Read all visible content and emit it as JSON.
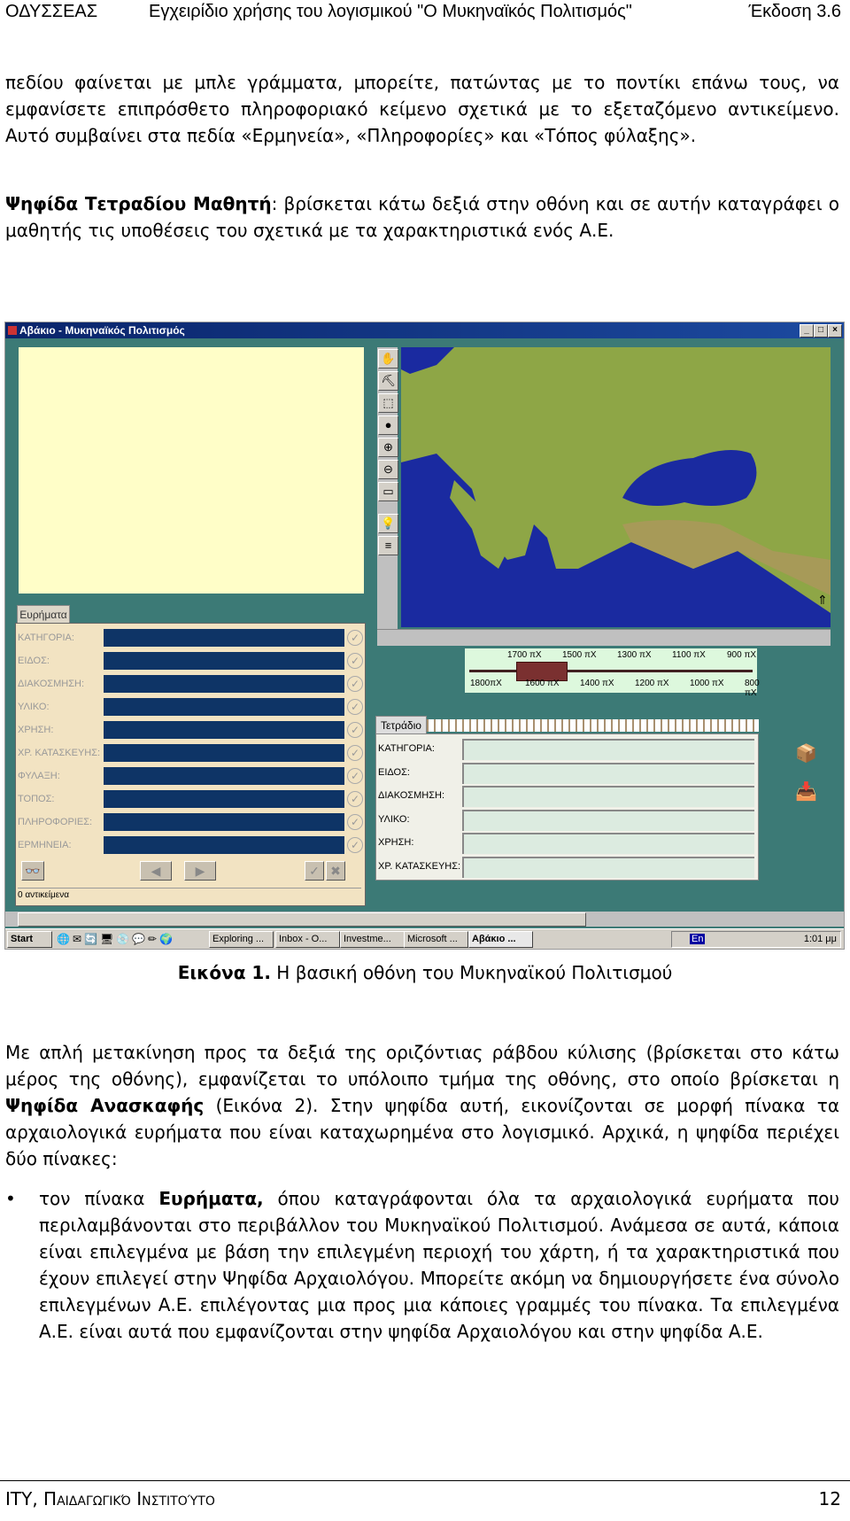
{
  "header": {
    "left": "ΟΔΥΣΣΕΑΣ",
    "center": "Εγχειρίδιο χρήσης του λογισμικού \"Ο Μυκηναϊκός Πολιτισμός\"",
    "right": "Έκδοση 3.6"
  },
  "intro": {
    "text": "πεδίου φαίνεται με μπλε γράμματα, μπορείτε, πατώντας με το ποντίκι επάνω τους, να εμφανίσετε επιπρόσθετο πληροφοριακό κείμενο σχετικά με το εξεταζόμενο αντικείμενο. Αυτό συμβαίνει στα πεδία «Ερμηνεία», «Πληροφορίες» και «Τόπος φύλαξης».",
    "bold_term": "Ψηφίδα Τετραδίου Μαθητή",
    "bold_rest": ": βρίσκεται κάτω δεξιά στην οθόνη και σε αυτήν καταγράφει ο μαθητής τις υποθέσεις του σχετικά με τα χαρακτηριστικά ενός Α.Ε."
  },
  "app": {
    "title": "Αβάκιο - Μυκηναϊκός Πολιτισμός",
    "window_buttons": [
      "_",
      "□",
      "×"
    ],
    "tools": [
      {
        "icon": "hand-icon",
        "glyph": "✋"
      },
      {
        "icon": "pickaxe-icon",
        "glyph": "⛏"
      },
      {
        "icon": "select-rect-icon",
        "glyph": "⬚"
      },
      {
        "icon": "point-icon",
        "glyph": "●"
      },
      {
        "icon": "zoom-in-icon",
        "glyph": "⊕"
      },
      {
        "icon": "zoom-out-icon",
        "glyph": "⊖"
      },
      {
        "icon": "ruler-icon",
        "glyph": "▭"
      },
      {
        "icon": "lightbulb-icon",
        "glyph": "💡"
      },
      {
        "icon": "legend-icon",
        "glyph": "≡"
      }
    ],
    "timeline": {
      "top_labels": [
        "1700 πΧ",
        "1500 πΧ",
        "1300 πΧ",
        "1100 πΧ",
        "900 πΧ"
      ],
      "bottom_labels": [
        "1800πΧ",
        "1600 πΧ",
        "1400 πΧ",
        "1200 πΧ",
        "1000 πΧ",
        "800 πΧ"
      ]
    },
    "findings": {
      "tab": "Ευρήματα",
      "fields": [
        "ΚΑΤΗΓΟΡΙΑ:",
        "ΕΙΔΟΣ:",
        "ΔΙΑΚΟΣΜΗΣΗ:",
        "ΥΛΙΚΟ:",
        "ΧΡΗΣΗ:",
        "ΧΡ. ΚΑΤΑΣΚΕΥΗΣ:",
        "ΦΥΛΑΞΗ:",
        "ΤΟΠΟΣ:",
        "ΠΛΗΡΟΦΟΡΙΕΣ:",
        "ΕΡΜΗΝΕΙΑ:"
      ],
      "status": "0 αντικείμενα",
      "bar_color": "#0e3466"
    },
    "notebook": {
      "tab": "Τετράδιο",
      "fields": [
        "ΚΑΤΗΓΟΡΙΑ:",
        "ΕΙΔΟΣ:",
        "ΔΙΑΚΟΣΜΗΣΗ:",
        "ΥΛΙΚΟ:",
        "ΧΡΗΣΗ:",
        "ΧΡ. ΚΑΤΑΣΚΕΥΗΣ:"
      ]
    },
    "taskbar": {
      "start": "Start",
      "tasks": [
        "Exploring ...",
        "Inbox - O...",
        "Investme...",
        "Microsoft ...",
        "Αβάκιο ..."
      ],
      "tray_lang": "En",
      "clock": "1:01 μμ"
    }
  },
  "caption": {
    "label": "Εικόνα 1.",
    "text": " Η βασική οθόνη του Μυκηναϊκού Πολιτισμού"
  },
  "body": {
    "p1_a": "Με απλή μετακίνηση προς τα δεξιά της οριζόντιας ράβδου κύλισης (βρίσκεται στο κάτω μέρος της οθόνης), εμφανίζεται το υπόλοιπο τμήμα της οθόνης, στο οποίο βρίσκεται η ",
    "p1_bold": "Ψηφίδα Ανασκαφής",
    "p1_b": " (Εικόνα 2). Στην ψηφίδα αυτή, εικονίζονται σε μορφή πίνακα τα αρχαιολογικά ευρήματα που είναι καταχωρημένα στο λογισμικό. Αρχικά, η ψηφίδα περιέχει δύο πίνακες:",
    "bullet_a": "τον πίνακα ",
    "bullet_bold": "Ευρήματα,",
    "bullet_b": " όπου καταγράφονται όλα τα αρχαιολογικά ευρήματα που περιλαμβάνονται στο περιβάλλον του Μυκηναϊκού Πολιτισμού. Ανάμεσα σε αυτά, κάποια είναι επιλεγμένα με βάση την επιλεγμένη περιοχή του χάρτη, ή τα χαρακτηριστικά που έχουν επιλεγεί στην Ψηφίδα Αρχαιολόγου. Μπορείτε ακόμη να δημιουργήσετε ένα σύνολο επιλεγμένων Α.Ε. επιλέγοντας μια προς μια κάποιες γραμμές του πίνακα. Τα επιλεγμένα Α.Ε. είναι αυτά που εμφανίζονται στην ψηφίδα Αρχαιολόγου και στην ψηφίδα Α.Ε.",
    "bullet_symbol": "•"
  },
  "footer": {
    "left": "ΙΤΥ, Παιδαγωγικό Ινστιτούτο",
    "page": "12"
  }
}
